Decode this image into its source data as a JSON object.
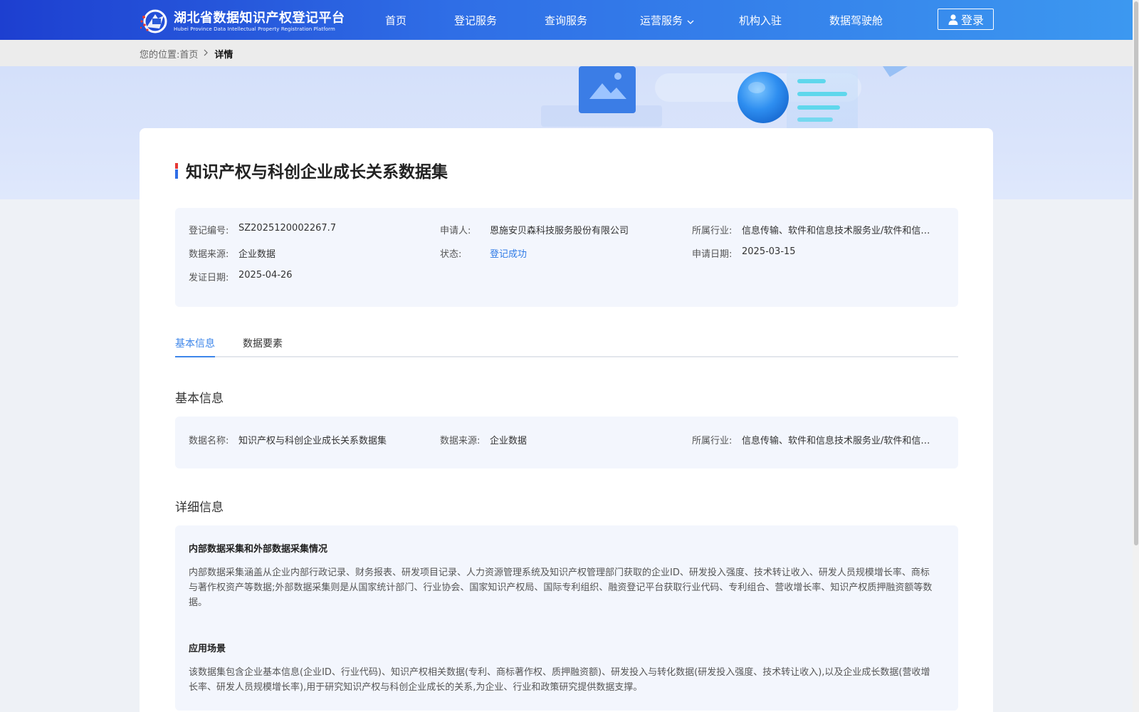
{
  "header": {
    "logo_cn": "湖北省数据知识产权登记平台",
    "logo_en": "Hubei Province Data Intellectual Property Registration Platform",
    "nav": [
      {
        "label": "首页"
      },
      {
        "label": "登记服务"
      },
      {
        "label": "查询服务"
      },
      {
        "label": "运营服务"
      },
      {
        "label": "机构入驻"
      },
      {
        "label": "数据驾驶舱"
      }
    ],
    "login_label": "登录"
  },
  "breadcrumb": {
    "prefix": "您的位置:",
    "home": "首页",
    "current": "详情"
  },
  "page": {
    "title": "知识产权与科创企业成长关系数据集"
  },
  "summary": {
    "reg_no_label": "登记编号:",
    "reg_no": "SZ2025120002267.7",
    "applicant_label": "申请人:",
    "applicant": "恩施安贝森科技服务股份有限公司",
    "industry_label": "所属行业:",
    "industry": "信息传输、软件和信息技术服务业/软件和信息技术服务业",
    "source_label": "数据来源:",
    "source": "企业数据",
    "status_label": "状态:",
    "status": "登记成功",
    "apply_date_label": "申请日期:",
    "apply_date": "2025-03-15",
    "issue_date_label": "发证日期:",
    "issue_date": "2025-04-26"
  },
  "tabs": [
    {
      "label": "基本信息"
    },
    {
      "label": "数据要素"
    }
  ],
  "basic": {
    "heading": "基本信息",
    "name_label": "数据名称:",
    "name": "知识产权与科创企业成长关系数据集",
    "source_label": "数据来源:",
    "source": "企业数据",
    "industry_label": "所属行业:",
    "industry": "信息传输、软件和信息技术服务业/软件和信息技术服务业"
  },
  "detail": {
    "heading": "详细信息",
    "collection_title": "内部数据采集和外部数据采集情况",
    "collection_text": "内部数据采集涵盖从企业内部行政记录、财务报表、研发项目记录、人力资源管理系统及知识产权管理部门获取的企业ID、研发投入强度、技术转让收入、研发人员规模增长率、商标与著作权资产等数据;外部数据采集则是从国家统计部门、行业协会、国家知识产权局、国际专利组织、融资登记平台获取行业代码、专利组合、营收增长率、知识产权质押融资额等数据。",
    "scenario_title": "应用场景",
    "scenario_text": "该数据集包含企业基本信息(企业ID、行业代码)、知识产权相关数据(专利、商标著作权、质押融资额)、研发投入与转化数据(研发投入强度、技术转让收入),以及企业成长数据(营收增长率、研发人员规模增长率),用于研究知识产权与科创企业成长的关系,为企业、行业和政策研究提供数据支撑。"
  },
  "colors": {
    "header_start": "#1d3fd0",
    "header_end": "#3c98f0",
    "accent": "#3d86ea",
    "panel_bg": "#f3f6fd",
    "status": "#2f7be6"
  }
}
